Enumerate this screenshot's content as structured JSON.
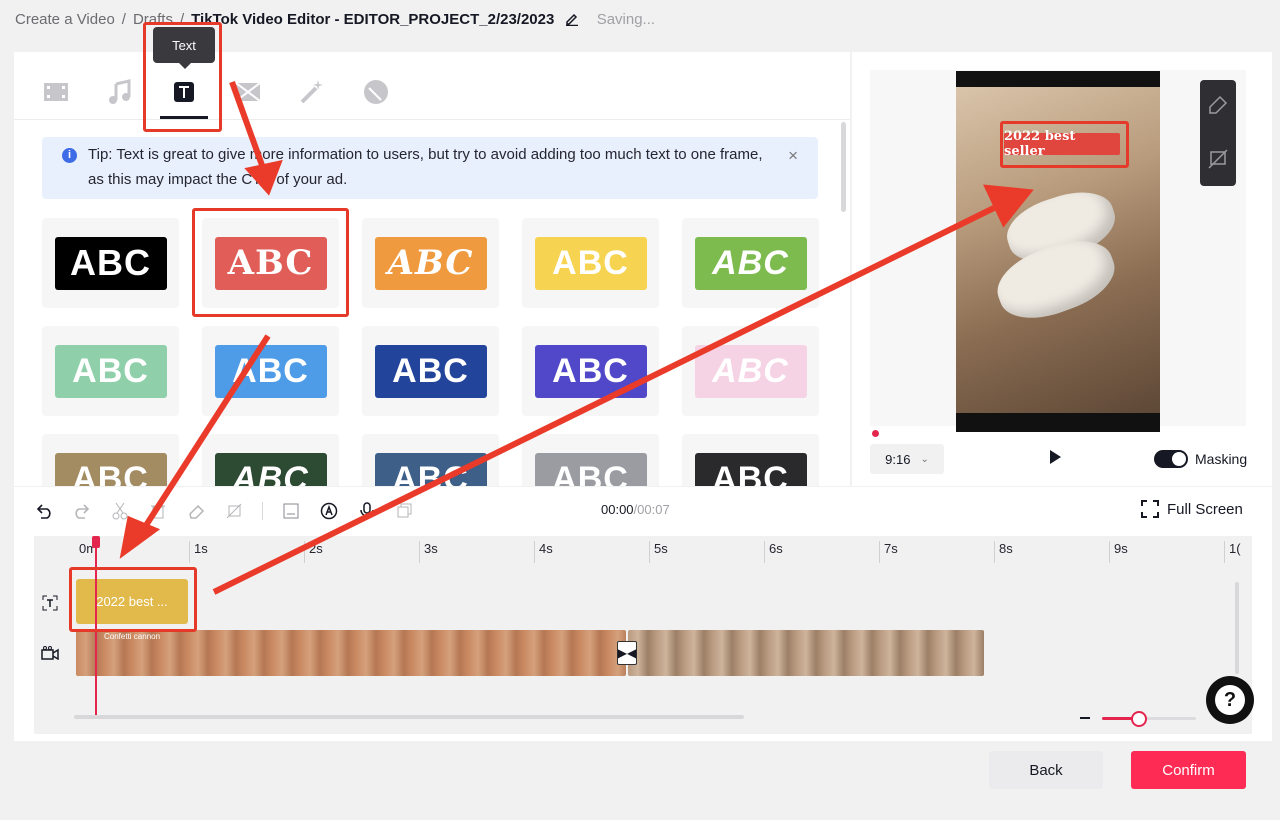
{
  "breadcrumb": {
    "create": "Create a Video",
    "drafts": "Drafts",
    "title": "TikTok Video Editor - EDITOR_PROJECT_2/23/2023",
    "status": "Saving...",
    "sep": "/"
  },
  "tabs": {
    "tooltip": "Text"
  },
  "tip": {
    "text": "Tip: Text is great to give more information to users, but try to avoid adding too much text to one frame, as this may impact the CTR of your ad.",
    "close": "×"
  },
  "templates": {
    "label": "ABC"
  },
  "preview": {
    "caption": "2022 best seller",
    "ratio": "9:16",
    "masking": "Masking"
  },
  "timeline": {
    "current": "00:00",
    "total": "/00:07",
    "fullscreen": "Full Screen",
    "ticks": [
      "0m",
      "1s",
      "2s",
      "3s",
      "4s",
      "5s",
      "6s",
      "7s",
      "8s",
      "9s",
      "1("
    ],
    "text_clip": "2022 best ...",
    "effect": "Confetti cannon"
  },
  "buttons": {
    "back": "Back",
    "confirm": "Confirm"
  },
  "help": "?"
}
